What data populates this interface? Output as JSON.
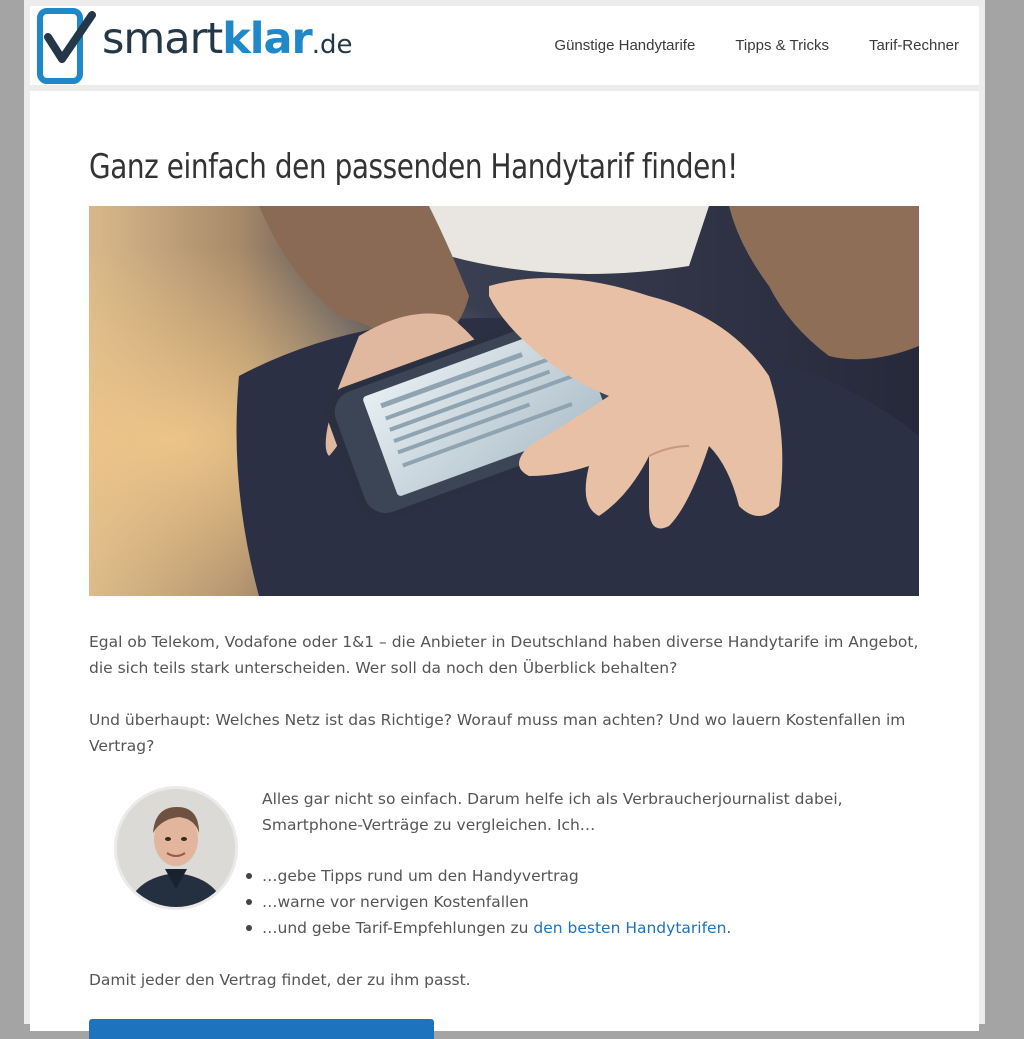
{
  "brand": {
    "name_part1": "smart",
    "name_part2": "klar",
    "name_part3": ".de",
    "colors": {
      "dark": "#243746",
      "accent": "#1e88c8",
      "link": "#1e73be"
    }
  },
  "nav": {
    "items": [
      {
        "label": "Günstige Handytarife"
      },
      {
        "label": "Tipps & Tricks"
      },
      {
        "label": "Tarif-Rechner"
      }
    ]
  },
  "main": {
    "title": "Ganz einfach den passenden Handytarif finden!",
    "paragraph1": "Egal ob Telekom, Vodafone oder 1&1 – die Anbieter in Deutschland haben diverse Handytarife im Angebot, die sich teils stark unterscheiden. Wer soll da noch den Überblick behalten?",
    "paragraph2": "Und überhaupt: Welches Netz ist das Richtige? Worauf muss man achten? Und wo lauern Kostenfallen im Vertrag?",
    "author_intro": "Alles gar nicht so einfach. Darum helfe ich als Verbraucherjournalist dabei, Smartphone-Verträge zu vergleichen. Ich…",
    "bullets": [
      {
        "text": "…gebe Tipps rund um den Handyvertrag"
      },
      {
        "text": "…warne vor nervigen Kostenfallen"
      },
      {
        "text_before": "…und gebe Tarif-Empfehlungen zu ",
        "link": "den besten Handytarifen",
        "text_after": "."
      }
    ],
    "closing": "Damit jeder den Vertrag findet, der zu ihm passt."
  }
}
